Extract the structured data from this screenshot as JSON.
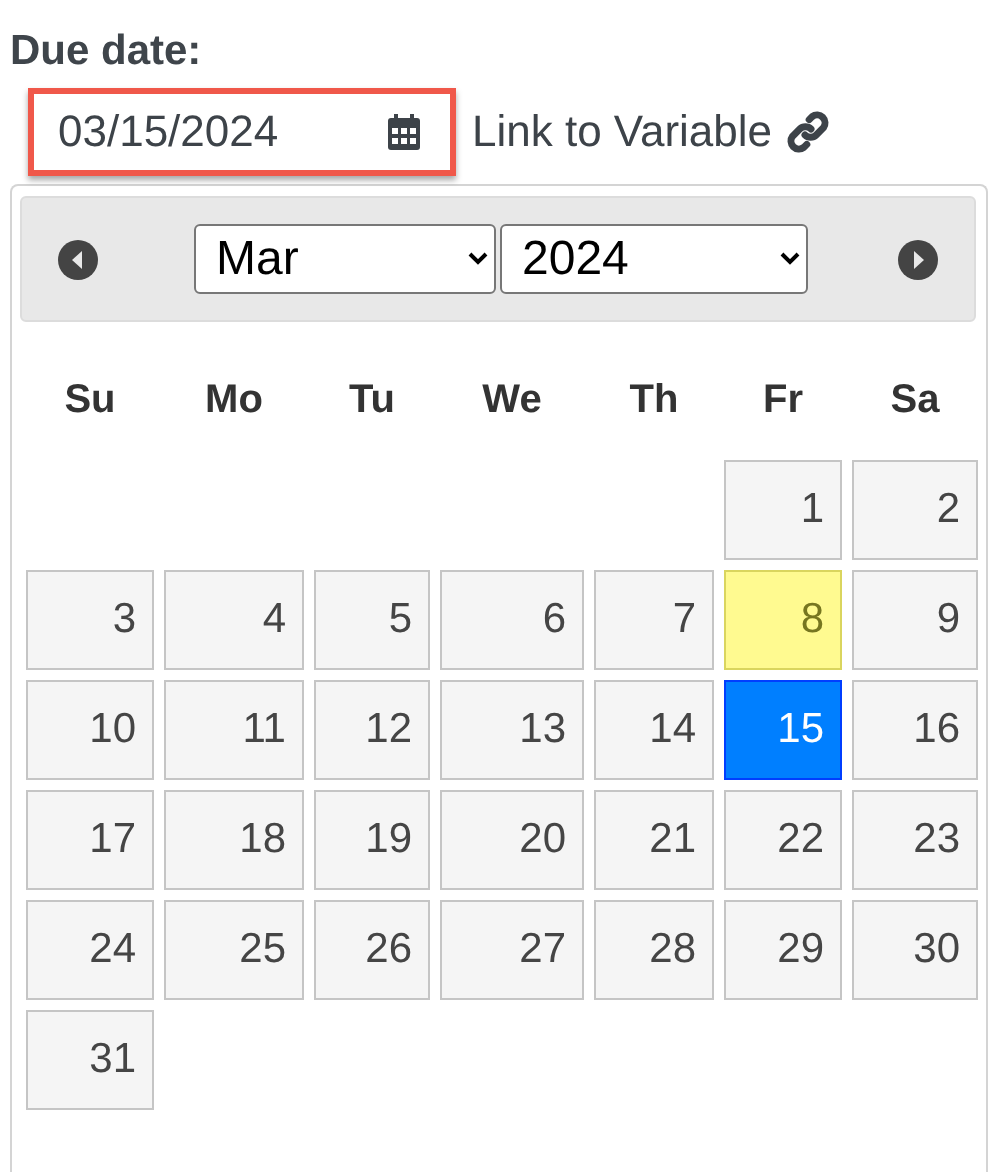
{
  "field_label": "Due date:",
  "date_field": {
    "value": "03/15/2024"
  },
  "link_to_variable": "Link to Variable",
  "calendar": {
    "month": "Mar",
    "year": "2024",
    "weekdays": [
      "Su",
      "Mo",
      "Tu",
      "We",
      "Th",
      "Fr",
      "Sa"
    ],
    "weeks": [
      [
        {
          "day": "1",
          "today": false,
          "selected": false
        },
        {
          "day": "2",
          "today": false,
          "selected": false
        }
      ],
      [
        {
          "day": "3",
          "today": false,
          "selected": false
        },
        {
          "day": "4",
          "today": false,
          "selected": false
        },
        {
          "day": "5",
          "today": false,
          "selected": false
        },
        {
          "day": "6",
          "today": false,
          "selected": false
        },
        {
          "day": "7",
          "today": false,
          "selected": false
        },
        {
          "day": "8",
          "today": true,
          "selected": false
        },
        {
          "day": "9",
          "today": false,
          "selected": false
        }
      ],
      [
        {
          "day": "10",
          "today": false,
          "selected": false
        },
        {
          "day": "11",
          "today": false,
          "selected": false
        },
        {
          "day": "12",
          "today": false,
          "selected": false
        },
        {
          "day": "13",
          "today": false,
          "selected": false
        },
        {
          "day": "14",
          "today": false,
          "selected": false
        },
        {
          "day": "15",
          "today": false,
          "selected": true
        },
        {
          "day": "16",
          "today": false,
          "selected": false
        }
      ],
      [
        {
          "day": "17",
          "today": false,
          "selected": false
        },
        {
          "day": "18",
          "today": false,
          "selected": false
        },
        {
          "day": "19",
          "today": false,
          "selected": false
        },
        {
          "day": "20",
          "today": false,
          "selected": false
        },
        {
          "day": "21",
          "today": false,
          "selected": false
        },
        {
          "day": "22",
          "today": false,
          "selected": false
        },
        {
          "day": "23",
          "today": false,
          "selected": false
        }
      ],
      [
        {
          "day": "24",
          "today": false,
          "selected": false
        },
        {
          "day": "25",
          "today": false,
          "selected": false
        },
        {
          "day": "26",
          "today": false,
          "selected": false
        },
        {
          "day": "27",
          "today": false,
          "selected": false
        },
        {
          "day": "28",
          "today": false,
          "selected": false
        },
        {
          "day": "29",
          "today": false,
          "selected": false
        },
        {
          "day": "30",
          "today": false,
          "selected": false
        }
      ],
      [
        {
          "day": "31",
          "today": false,
          "selected": false
        }
      ]
    ]
  }
}
